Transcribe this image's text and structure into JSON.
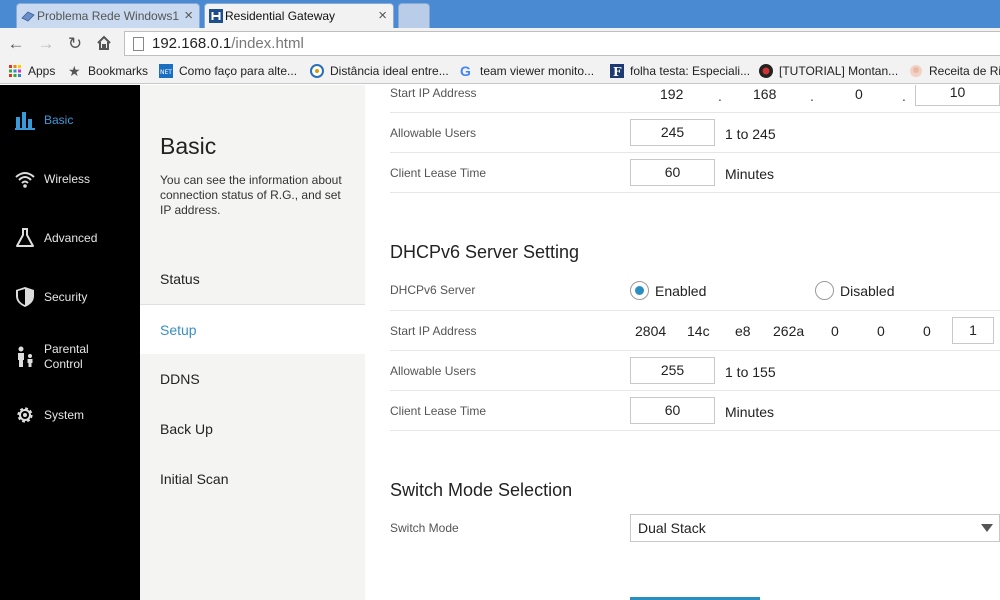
{
  "browser": {
    "tabs": [
      {
        "label": "Problema Rede Windows1",
        "active": false
      },
      {
        "label": "Residential Gateway",
        "active": true
      }
    ],
    "url_host": "192.168.0.1",
    "url_path": "/index.html",
    "bookmarks": [
      {
        "label": "Apps",
        "icon": "apps-grid-icon"
      },
      {
        "label": "Bookmarks",
        "icon": "star-icon"
      },
      {
        "label": "Como faço para alte...",
        "icon": "net-favicon"
      },
      {
        "label": "Distância ideal entre...",
        "icon": "site-favicon"
      },
      {
        "label": "team viewer monito...",
        "icon": "google-favicon"
      },
      {
        "label": "folha testa: Especiali...",
        "icon": "f-favicon"
      },
      {
        "label": "[TUTORIAL] Montan...",
        "icon": "forum-favicon"
      },
      {
        "label": "Receita de Ri",
        "icon": "recipe-favicon"
      }
    ]
  },
  "sidebar": {
    "items": [
      {
        "label": "Basic",
        "icon": "bar-chart-icon",
        "active": true
      },
      {
        "label": "Wireless",
        "icon": "wifi-icon",
        "active": false
      },
      {
        "label": "Advanced",
        "icon": "flask-icon",
        "active": false
      },
      {
        "label": "Security",
        "icon": "shield-icon",
        "active": false
      },
      {
        "label": "Parental",
        "label2": "Control",
        "icon": "parent-child-icon",
        "active": false
      },
      {
        "label": "System",
        "icon": "gear-icon",
        "active": false
      }
    ]
  },
  "subnav": {
    "title": "Basic",
    "description": "You can see the information about connection status of R.G., and set IP address.",
    "items": [
      {
        "label": "Status",
        "active": false
      },
      {
        "label": "Setup",
        "active": true
      },
      {
        "label": "DDNS",
        "active": false
      },
      {
        "label": "Back Up",
        "active": false
      },
      {
        "label": "Initial Scan",
        "active": false
      }
    ]
  },
  "dhcp": {
    "start_ip_label": "Start IP Address",
    "start_ip": [
      "192",
      "168",
      "0",
      "10"
    ],
    "allowable_users_label": "Allowable Users",
    "allowable_users": "245",
    "allowable_users_range": "1 to 245",
    "lease_label": "Client Lease Time",
    "lease": "60",
    "lease_unit": "Minutes"
  },
  "dhcpv6": {
    "title": "DHCPv6 Server Setting",
    "server_label": "DHCPv6 Server",
    "enabled_label": "Enabled",
    "disabled_label": "Disabled",
    "selected": "Enabled",
    "start_ip_label": "Start IP Address",
    "start_ip": [
      "2804",
      "14c",
      "e8",
      "262a",
      "0",
      "0",
      "0",
      "1"
    ],
    "allowable_users_label": "Allowable Users",
    "allowable_users": "255",
    "allowable_users_range": "1 to 155",
    "lease_label": "Client Lease Time",
    "lease": "60",
    "lease_unit": "Minutes"
  },
  "switch_mode": {
    "title": "Switch Mode Selection",
    "label": "Switch Mode",
    "selected": "Dual Stack"
  },
  "colors": {
    "accent": "#2a8fc0",
    "sidebar_bg": "#000000",
    "tabstrip": "#4a8ad3"
  }
}
